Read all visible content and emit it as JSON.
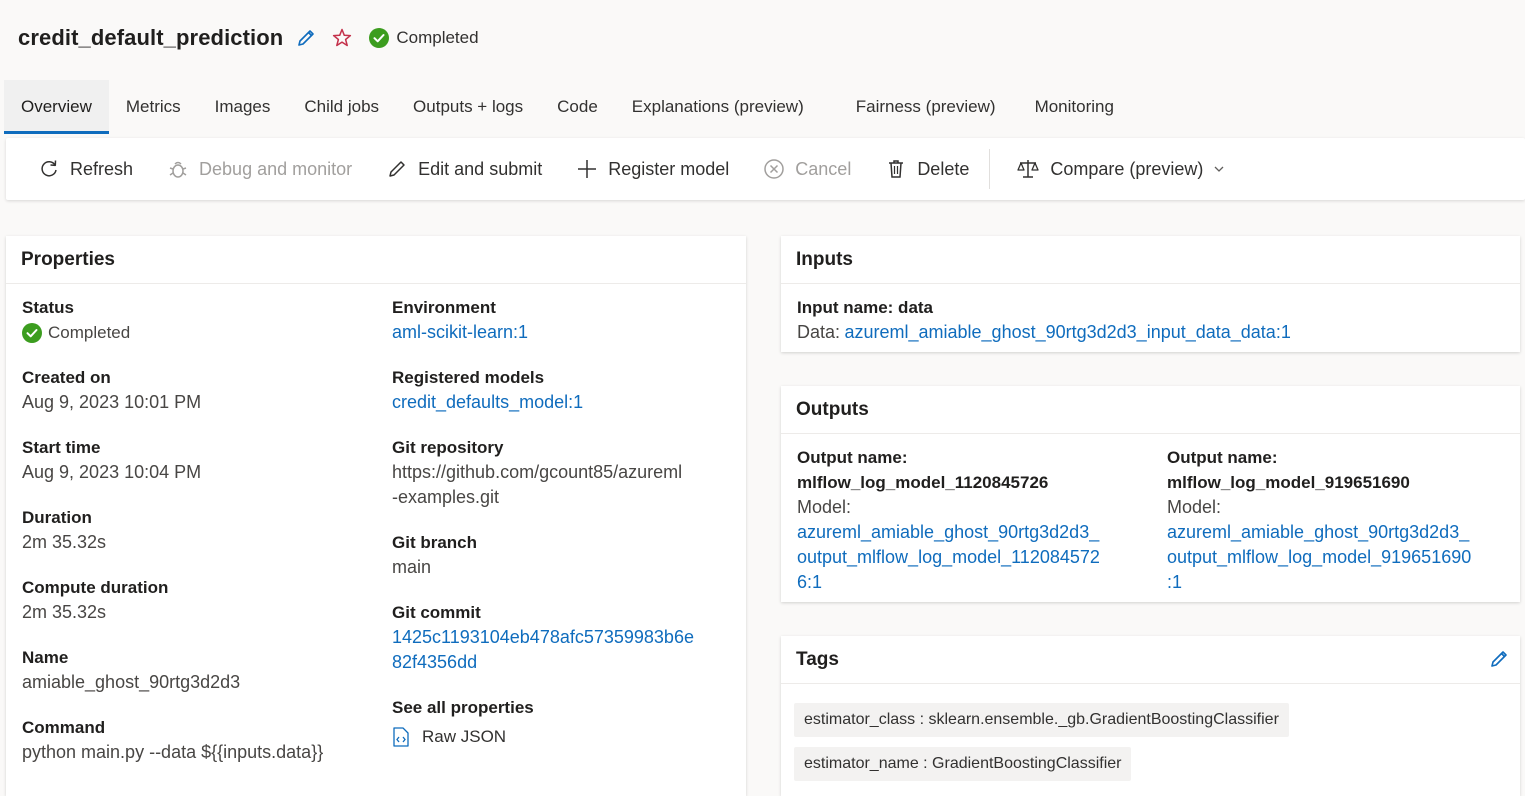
{
  "header": {
    "title": "credit_default_prediction",
    "status": "Completed"
  },
  "tabs": [
    {
      "label": "Overview",
      "active": true
    },
    {
      "label": "Metrics"
    },
    {
      "label": "Images"
    },
    {
      "label": "Child jobs"
    },
    {
      "label": "Outputs + logs"
    },
    {
      "label": "Code"
    },
    {
      "label": "Explanations (preview)"
    },
    {
      "label": "Fairness (preview)"
    },
    {
      "label": "Monitoring"
    }
  ],
  "toolbar": {
    "refresh": "Refresh",
    "debug": "Debug and monitor",
    "edit_submit": "Edit and submit",
    "register_model": "Register model",
    "cancel": "Cancel",
    "delete": "Delete",
    "compare": "Compare (preview)"
  },
  "properties": {
    "title": "Properties",
    "status_label": "Status",
    "status_value": "Completed",
    "created_label": "Created on",
    "created_value": "Aug 9, 2023 10:01 PM",
    "start_label": "Start time",
    "start_value": "Aug 9, 2023 10:04 PM",
    "duration_label": "Duration",
    "duration_value": "2m 35.32s",
    "compute_label": "Compute duration",
    "compute_value": "2m 35.32s",
    "name_label": "Name",
    "name_value": "amiable_ghost_90rtg3d2d3",
    "command_label": "Command",
    "command_value": "python main.py --data ${{inputs.data}}",
    "env_label": "Environment",
    "env_value": "aml-scikit-learn:1",
    "models_label": "Registered models",
    "models_value": "credit_defaults_model:1",
    "git_repo_label": "Git repository",
    "git_repo_value_line1": "https://github.com/gcount85/azureml",
    "git_repo_value_line2": "-examples.git",
    "git_branch_label": "Git branch",
    "git_branch_value": "main",
    "git_commit_label": "Git commit",
    "git_commit_line1": "1425c1193104eb478afc57359983b6e",
    "git_commit_line2": "82f4356dd",
    "see_all_label": "See all properties",
    "raw_json": "Raw JSON"
  },
  "inputs": {
    "title": "Inputs",
    "input_name": "Input name: data",
    "data_label": "Data:",
    "data_value": "azureml_amiable_ghost_90rtg3d2d3_input_data_data:1"
  },
  "outputs": {
    "title": "Outputs",
    "items": [
      {
        "name_label": "Output name:",
        "name_value": "mlflow_log_model_1120845726",
        "model_label": "Model:",
        "model_line1": "azureml_amiable_ghost_90rtg3d2d3_",
        "model_line2": "output_mlflow_log_model_112084572",
        "model_line3": "6:1"
      },
      {
        "name_label": "Output name:",
        "name_value": "mlflow_log_model_919651690",
        "model_label": "Model:",
        "model_line1": "azureml_amiable_ghost_90rtg3d2d3_",
        "model_line2": "output_mlflow_log_model_919651690",
        "model_line3": ":1"
      }
    ]
  },
  "tags": {
    "title": "Tags",
    "items": [
      "estimator_class : sklearn.ensemble._gb.GradientBoostingClassifier",
      "estimator_name : GradientBoostingClassifier"
    ]
  },
  "colors": {
    "accent": "#0f6cbd",
    "success": "#3c9d1f",
    "star": "#c4314b"
  }
}
